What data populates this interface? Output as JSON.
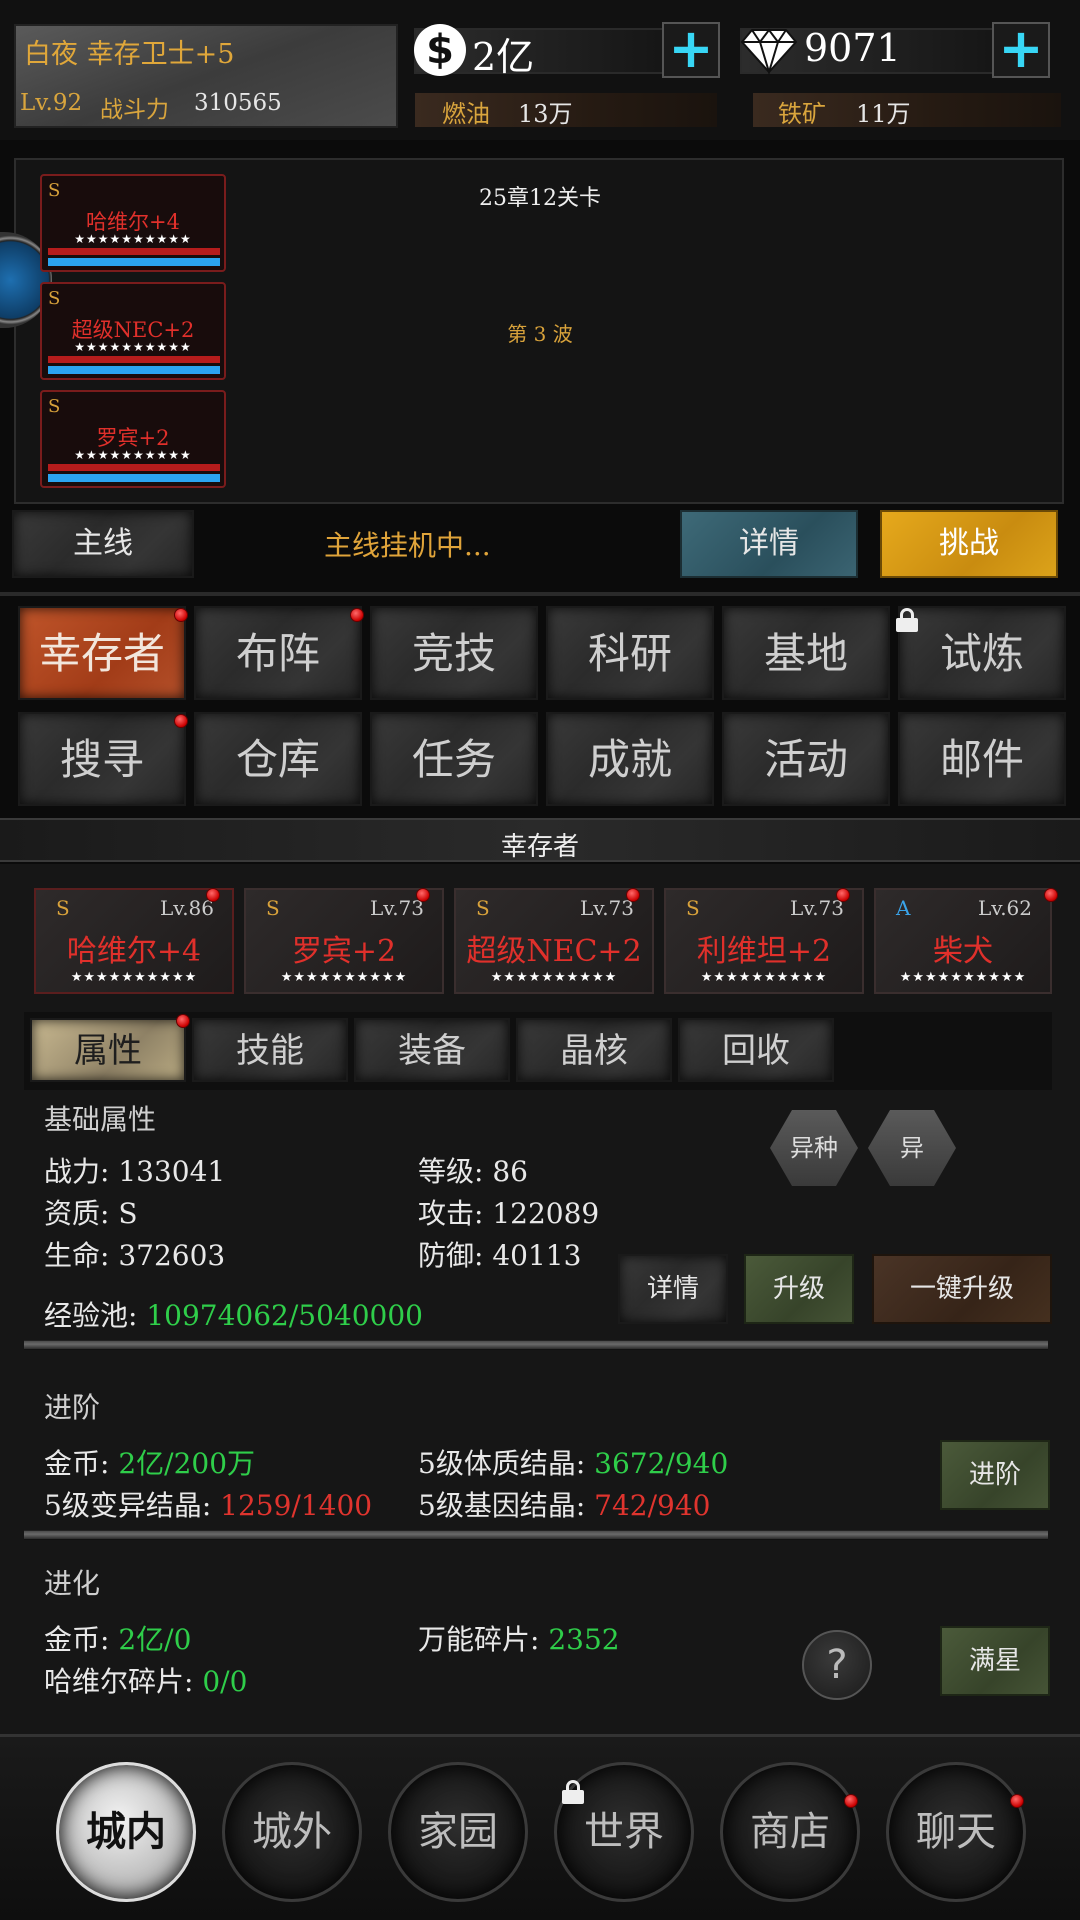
{
  "header": {
    "player_name": "白夜 幸存卫士+5",
    "level_label": "Lv.92",
    "power_label": "战斗力",
    "power_value": "310565",
    "gold": "2亿",
    "gems": "9071",
    "fuel_label": "燃油",
    "fuel_value": "13万",
    "iron_label": "铁矿",
    "iron_value": "11万"
  },
  "battle": {
    "stage": "25章12关卡",
    "wave": "第 3 波",
    "team": [
      {
        "grade": "S",
        "name": "哈维尔+4",
        "stars": "★★★★★★★★★★"
      },
      {
        "grade": "S",
        "name": "超级NEC+2",
        "stars": "★★★★★★★★★★"
      },
      {
        "grade": "S",
        "name": "罗宾+2",
        "stars": "★★★★★★★★★★"
      }
    ]
  },
  "mainline": {
    "mode_label": "主线",
    "status": "主线挂机中...",
    "details_label": "详情",
    "challenge_label": "挑战"
  },
  "menu": {
    "row1": [
      "幸存者",
      "布阵",
      "竞技",
      "科研",
      "基地",
      "试炼"
    ],
    "row2": [
      "搜寻",
      "仓库",
      "任务",
      "成就",
      "活动",
      "邮件"
    ]
  },
  "section_title": "幸存者",
  "heroes": [
    {
      "grade": "S",
      "level": "Lv.86",
      "name": "哈维尔+4",
      "stars": "★★★★★★★★★★"
    },
    {
      "grade": "S",
      "level": "Lv.73",
      "name": "罗宾+2",
      "stars": "★★★★★★★★★★"
    },
    {
      "grade": "S",
      "level": "Lv.73",
      "name": "超级NEC+2",
      "stars": "★★★★★★★★★★"
    },
    {
      "grade": "S",
      "level": "Lv.73",
      "name": "利维坦+2",
      "stars": "★★★★★★★★★★"
    },
    {
      "grade": "A",
      "level": "Lv.62",
      "name": "柴犬",
      "stars": "★★★★★★★★★★"
    }
  ],
  "tabs": [
    "属性",
    "技能",
    "装备",
    "晶核",
    "回收"
  ],
  "basic": {
    "title": "基础属性",
    "power": "战力: 133041",
    "level": "等级: 86",
    "quality": "资质: S",
    "attack": "攻击: 122089",
    "hp": "生命: 372603",
    "defense": "防御: 40113",
    "exp_label": "经验池: ",
    "exp_value": "10974062/5040000",
    "hex1": "异种",
    "hex2": "异",
    "details_btn": "详情",
    "upgrade_btn": "升级",
    "oneclick_btn": "一键升级"
  },
  "advance": {
    "title": "进阶",
    "gold_label": "金币: ",
    "gold_value": "2亿/200万",
    "c1_label": "5级体质结晶: ",
    "c1_value": "3672/940",
    "c2_label": "5级变异结晶: ",
    "c2_value": "1259/1400",
    "c3_label": "5级基因结晶: ",
    "c3_value": "742/940",
    "btn": "进阶"
  },
  "evolve": {
    "title": "进化",
    "gold_label": "金币: ",
    "gold_value": "2亿/0",
    "frag_label": "万能碎片: ",
    "frag_value": "2352",
    "shard_label": "哈维尔碎片: ",
    "shard_value": "0/0",
    "help": "?",
    "btn": "满星"
  },
  "nav": [
    "城内",
    "城外",
    "家园",
    "世界",
    "商店",
    "聊天"
  ],
  "colors": {
    "accent_gold": "#d8a23b",
    "red_name": "#e0302b",
    "green": "#2fce4a",
    "cyan": "#38d6f5"
  }
}
